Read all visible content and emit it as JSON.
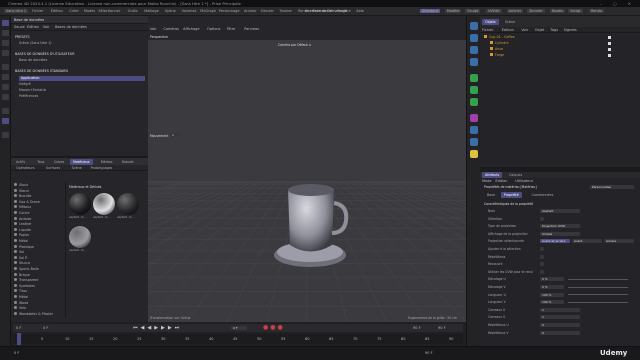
{
  "window": {
    "title": "Cinema 4D 2024.4.1 (License Education - License non-commerciale pour Malko Rouchin) - [Sans titre 1 *] - Prise Principale"
  },
  "menubar": {
    "file_tab": "Sans titre 1",
    "items": [
      "Fichier",
      "Édition",
      "Créer",
      "Modes",
      "Sélectionner",
      "Outils",
      "Maillage",
      "Spline",
      "Volumes",
      "MoGraph",
      "Personnage",
      "Animer",
      "Simuler",
      "Tracker",
      "Rendu",
      "Extensions",
      "Fenêtre",
      "Aide"
    ],
    "layout_label": "Interface de Démarrage",
    "mode_tabs": [
      "Standard",
      "Modèle",
      "Sculpt",
      "UVEdit",
      "Animer",
      "Simuler",
      "Nodes",
      "Script",
      "Rendu"
    ]
  },
  "asset_browser": {
    "title": "Base de données",
    "header_tabs": [
      "Sauve",
      "Édition",
      "Voir",
      "Bases de données"
    ],
    "sections": [
      {
        "label": "PRESETS"
      },
      {
        "label": "BASES DE DONNÉES D'UTILISATEUR"
      },
      {
        "label": "BASES DE DONNÉES STANDARD"
      }
    ],
    "items": [
      "Scène (Sans titre 1)",
      "Base de données",
      "Application",
      "Intégré",
      "Maxon+ExtraLib",
      "Préférences"
    ],
    "selected": "Application"
  },
  "bottom_left": {
    "tabs": [
      "Actifs",
      "Tous",
      "Cubes",
      "Matériaux",
      "Médias",
      "Nœuds"
    ],
    "active_tab": "Matériaux",
    "subtabs": [
      "Opérateurs",
      "Surfaces",
      "Scène",
      "Prototypages"
    ],
    "tree": [
      "Stock",
      "Stand",
      "Brouille",
      "Gaz & Drone",
      "Métaux",
      "Cuivre",
      "Ardoise",
      "Leather",
      "Liquide",
      "Papier",
      "Métal",
      "Plastique",
      "Sol",
      "Sol P.",
      "Stucco",
      "Sports Balle",
      "Brique",
      "Transparent",
      "Symboles",
      "Tissu",
      "Métal",
      "Wood",
      "Velo",
      "Wondables & Plaster"
    ],
    "grid_title": "Matériaux et Dérivés",
    "materials": [
      {
        "name": "Asphalt - D...",
        "color": "#1e1e20"
      },
      {
        "name": "Asphalt - D...",
        "color": "#e0e0e2"
      },
      {
        "name": "Asphalt - D...",
        "color": "#272729"
      },
      {
        "name": "Asphalt - D...",
        "color": "#9a9aa0"
      }
    ]
  },
  "viewport": {
    "menu": [
      "Voir",
      "Caméras",
      "Affichage",
      "Options",
      "Filtre",
      "Panneau"
    ],
    "projection": "Perspective",
    "camera": "Caméra par Défaut ⊙",
    "movement_label": "Mouvement",
    "move_value": "1",
    "footer_left": "Transformation sur: Scène",
    "footer_right": "Espacement de la grille : 50 cm"
  },
  "object_manager": {
    "tabs": [
      "Objets",
      "Scène"
    ],
    "menu": [
      "Fichier",
      "Édition",
      "Voir",
      "Objet",
      "Tags",
      "Signets"
    ],
    "objects": [
      {
        "name": "Cup 01 - Coffee",
        "color": "#d59a2e"
      },
      {
        "name": "Cylindre",
        "color": "#d59a2e"
      },
      {
        "name": "Anse",
        "color": "#d59a2e"
      },
      {
        "name": "Forge",
        "color": "#d59a2e"
      }
    ]
  },
  "attributes": {
    "tabs": [
      "Attributs",
      "Calques"
    ],
    "menu": [
      "Mode",
      "Édition",
      "Utilisateur"
    ],
    "object_title": "Propriétés de matériau [Matériau]",
    "mode_value": "Personnalisé",
    "subtabs": [
      "Base",
      "Propriété",
      "Coordonnées"
    ],
    "active_subtab": "Propriété",
    "section": "Caractéristiques de la propriété",
    "fields": [
      {
        "label": "Nom",
        "value": "Asphalt"
      },
      {
        "label": "Sélection",
        "value": ""
      },
      {
        "label": "Type de projection",
        "value": "Projection UVW"
      },
      {
        "label": "Affichage de la projection",
        "value": "Simple"
      },
      {
        "label": "Projection sélectionnée",
        "value": "Avant et arrière"
      },
      {
        "label": "Ajouter à la sélection",
        "value": ""
      },
      {
        "label": "Répétitions",
        "value": ""
      },
      {
        "label": "Recouvrir",
        "value": ""
      },
      {
        "label": "Utiliser les UVW pour le recul",
        "value": ""
      },
      {
        "label": "Décalage U",
        "value": "0 %"
      },
      {
        "label": "Décalage V",
        "value": "0 %"
      },
      {
        "label": "Longueur U",
        "value": "100 %"
      },
      {
        "label": "Longueur V",
        "value": "100 %"
      },
      {
        "label": "Carreaux U",
        "value": "1"
      },
      {
        "label": "Carreaux V",
        "value": "1"
      },
      {
        "label": "Répétitions U",
        "value": "0"
      },
      {
        "label": "Répétitions V",
        "value": "0"
      }
    ],
    "projection_side_options": [
      "Avant et arrière",
      "Avant",
      "Arrière"
    ]
  },
  "timeline": {
    "start": "0 F",
    "current": "0 F",
    "end": "90 F",
    "end2": "90 F",
    "frame_field": "0 F",
    "ticks": [
      "0",
      "5",
      "10",
      "15",
      "20",
      "25",
      "30",
      "35",
      "40",
      "45",
      "50",
      "55",
      "60",
      "65",
      "70",
      "75",
      "80",
      "85",
      "90"
    ]
  },
  "statusbar": {
    "left": "0 F",
    "right": "90 F",
    "watermark": "Udemy"
  },
  "colors": {
    "accent": "#5a5a8e",
    "orange": "#d59a2e"
  }
}
